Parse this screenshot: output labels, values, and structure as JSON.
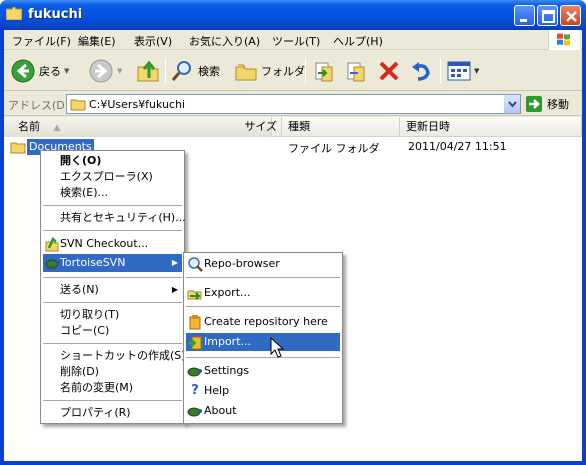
{
  "window": {
    "title": "fukuchi"
  },
  "menubar": [
    "ファイル(F)",
    "編集(E)",
    "表示(V)",
    "お気に入り(A)",
    "ツール(T)",
    "ヘルプ(H)"
  ],
  "toolbar": {
    "back_label": "戻る",
    "search_label": "検索",
    "folders_label": "フォルダ"
  },
  "address": {
    "label": "アドレス(D)",
    "path": "C:¥Users¥fukuchi",
    "go_label": "移動"
  },
  "columns": {
    "name": "名前",
    "size": "サイズ",
    "type": "種類",
    "date": "更新日時"
  },
  "file": {
    "name": "Documents",
    "size": "",
    "type": "ファイル フォルダ",
    "date": "2011/04/27 11:51"
  },
  "context_menu": {
    "items": [
      "開く(O)",
      "エクスプローラ(X)",
      "検索(E)...",
      "共有とセキュリティ(H)...",
      "SVN Checkout...",
      "TortoiseSVN",
      "送る(N)",
      "切り取り(T)",
      "コピー(C)",
      "ショートカットの作成(S)",
      "削除(D)",
      "名前の変更(M)",
      "プロパティ(R)"
    ]
  },
  "submenu": {
    "items": [
      "Repo-browser",
      "Export...",
      "Create repository here",
      "Import...",
      "Settings",
      "Help",
      "About"
    ]
  },
  "colors": {
    "title_blue": "#0553e0",
    "selection": "#316ac5",
    "face": "#ece9d8"
  }
}
